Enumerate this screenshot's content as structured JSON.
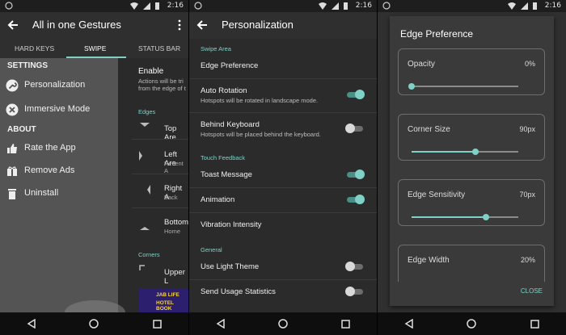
{
  "status": {
    "time": "2:16"
  },
  "panel1": {
    "title": "All in one Gestures",
    "tabs": [
      "HARD KEYS",
      "SWIPE",
      "STATUS BAR"
    ],
    "drawer": {
      "settings_header": "SETTINGS",
      "personalization": "Personalization",
      "immersive": "Immersive Mode",
      "about_header": "ABOUT",
      "rate": "Rate the App",
      "remove_ads": "Remove Ads",
      "uninstall": "Uninstall"
    },
    "right": {
      "enable": "Enable",
      "enable_sub1": "Actions will be tri",
      "enable_sub2": "from the edge of t",
      "edges_header": "Edges",
      "top": "Top Are",
      "left": "Left Are",
      "left_sub": "Recent A",
      "right": "Right A",
      "right_sub": "Back",
      "bottom": "Bottom",
      "bottom_sub": "Home",
      "corners_header": "Corners",
      "upper": "Upper L",
      "ad1": "JAB LIFE",
      "ad2": "HOTEL BOOK"
    }
  },
  "panel2": {
    "title": "Personalization",
    "swipe_area": "Swipe Area",
    "edge_pref": "Edge Preference",
    "auto_rotation": "Auto Rotation",
    "auto_rotation_sub": "Hotspots will be rotated in landscape mode.",
    "behind_keyboard": "Behind Keyboard",
    "behind_keyboard_sub": "Hotspots will be placed behind the keyboard.",
    "touch_feedback": "Touch Feedback",
    "toast": "Toast Message",
    "animation": "Animation",
    "vibration": "Vibration Intensity",
    "general": "General",
    "light_theme": "Use Light Theme",
    "usage_stats": "Send Usage Statistics",
    "toggles": {
      "auto_rotation": true,
      "behind_keyboard": false,
      "toast": true,
      "animation": true,
      "light_theme": false,
      "usage_stats": false
    }
  },
  "panel3": {
    "dialog_title": "Edge Preference",
    "opacity_label": "Opacity",
    "opacity_value": "0%",
    "opacity_level": 0,
    "corner_label": "Corner Size",
    "corner_value": "90px",
    "corner_level": 0.6,
    "sensitivity_label": "Edge Sensitivity",
    "sensitivity_value": "70px",
    "sensitivity_level": 0.7,
    "width_label": "Edge Width",
    "width_value": "20%",
    "close": "CLOSE"
  },
  "colors": {
    "accent": "#7fd1c7",
    "drawer": "#545454",
    "background": "#2b2b2b"
  }
}
